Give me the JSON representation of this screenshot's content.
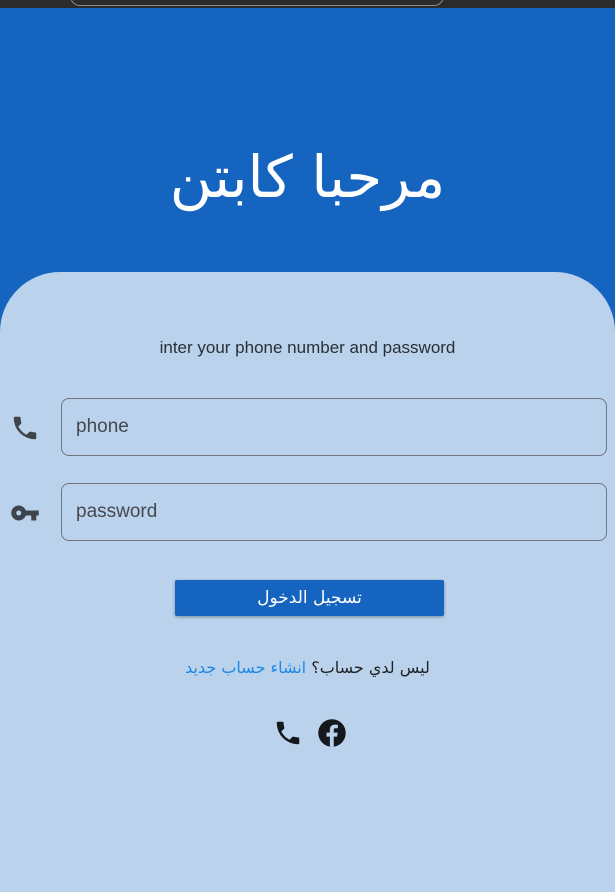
{
  "header": {
    "title": "مرحبا كابتن"
  },
  "form": {
    "subtitle": "inter your phone number and password",
    "phone": {
      "placeholder": "phone",
      "value": "",
      "icon": "phone-icon"
    },
    "password": {
      "placeholder": "password",
      "value": "",
      "icon": "key-icon"
    },
    "login_label": "تسجيل الدخول",
    "signup_prompt": "ليس لدي حساب؟",
    "signup_link": "انشاء حساب جديد"
  },
  "social": {
    "icons": [
      "phone-icon",
      "facebook-icon"
    ]
  },
  "colors": {
    "primary": "#1565c0",
    "panel": "#bbd2ec",
    "link": "#1e88e5",
    "topbar": "#2b2b2b"
  }
}
